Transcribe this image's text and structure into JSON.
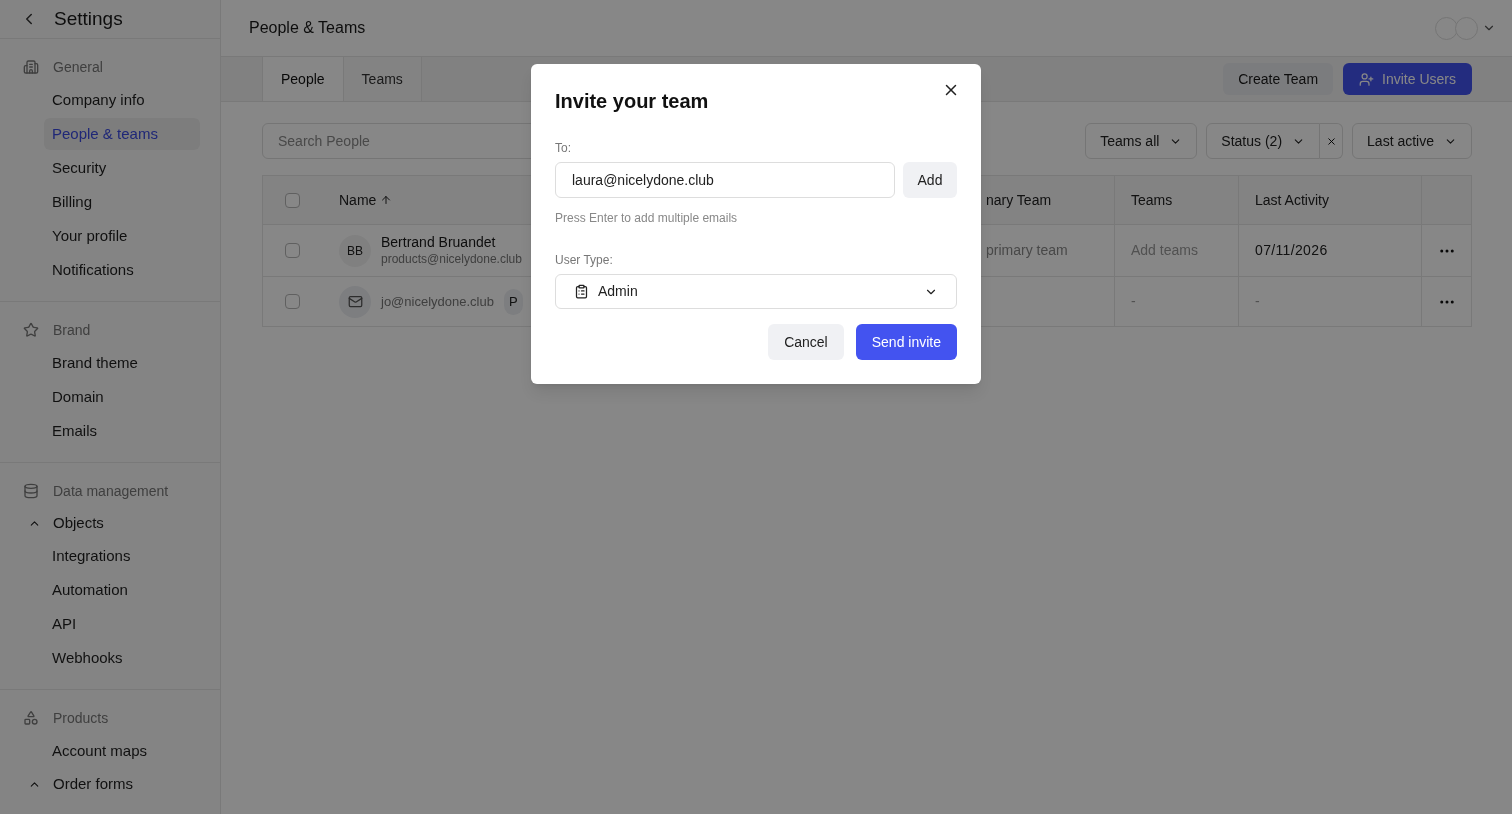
{
  "sidebar": {
    "title": "Settings",
    "sections": [
      {
        "heading": "General",
        "items": [
          {
            "kind": "link",
            "label": "Company info",
            "selected": false
          },
          {
            "kind": "link",
            "label": "People & teams",
            "selected": true
          },
          {
            "kind": "link",
            "label": "Security",
            "selected": false
          },
          {
            "kind": "link",
            "label": "Billing",
            "selected": false
          },
          {
            "kind": "link",
            "label": "Your profile",
            "selected": false
          },
          {
            "kind": "link",
            "label": "Notifications",
            "selected": false
          }
        ]
      },
      {
        "heading": "Brand",
        "items": [
          {
            "kind": "link",
            "label": "Brand theme",
            "selected": false
          },
          {
            "kind": "link",
            "label": "Domain",
            "selected": false
          },
          {
            "kind": "link",
            "label": "Emails",
            "selected": false
          }
        ]
      },
      {
        "heading": "Data management",
        "items": [
          {
            "kind": "group",
            "label": "Objects",
            "expanded": true,
            "children": [
              {
                "kind": "link",
                "label": "Integrations",
                "selected": false
              },
              {
                "kind": "link",
                "label": "Automation",
                "selected": false
              },
              {
                "kind": "link",
                "label": "API",
                "selected": false
              },
              {
                "kind": "link",
                "label": "Webhooks",
                "selected": false
              }
            ]
          }
        ]
      },
      {
        "heading": "Products",
        "items": [
          {
            "kind": "link",
            "label": "Account maps",
            "selected": false
          },
          {
            "kind": "group",
            "label": "Order forms",
            "expanded": true
          }
        ]
      }
    ]
  },
  "header": {
    "title": "People & Teams"
  },
  "tabs": [
    {
      "label": "People",
      "selected": true
    },
    {
      "label": "Teams",
      "selected": false
    }
  ],
  "actions": {
    "create": "Create Team",
    "invite": "Invite Users"
  },
  "search": {
    "placeholder": "Search People"
  },
  "filters": [
    {
      "label": "Teams all",
      "clearable": false
    },
    {
      "label": "Status (2)",
      "clearable": true
    },
    {
      "label": "Last active",
      "clearable": false
    }
  ],
  "table": {
    "header_checked": false,
    "columns": [
      {
        "label": "Name",
        "sorted": true
      },
      {
        "label": "nary Team",
        "sorted": false
      },
      {
        "label": "Teams",
        "sorted": false
      },
      {
        "label": "Last Activity",
        "sorted": false
      }
    ],
    "rows": [
      {
        "kind": "person",
        "checked": false,
        "initials": "BB",
        "name": "Bertrand Bruandet",
        "email": "products@nicelydone.club",
        "primary_team": "primary team",
        "teams": "Add teams",
        "last_activity": "07/11/2026"
      },
      {
        "kind": "invite",
        "checked": false,
        "email": "jo@nicelydone.club",
        "badge": "P",
        "teams": "-",
        "last_activity": "-"
      }
    ]
  },
  "modal": {
    "title": "Invite your team",
    "to_label": "To:",
    "to_value": "laura@nicelydone.club",
    "add": "Add",
    "hint": "Press Enter to add multiple emails",
    "type_label": "User Type:",
    "type_value": "Admin",
    "cancel": "Cancel",
    "send": "Send invite"
  }
}
